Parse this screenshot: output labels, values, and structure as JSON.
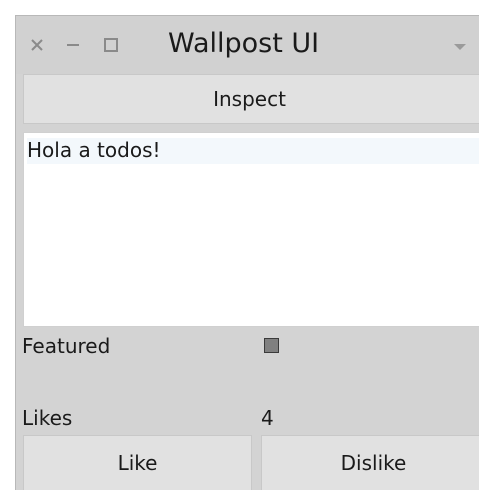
{
  "window": {
    "title": "Wallpost UI",
    "controls": {
      "close": "close-icon",
      "minimize": "minimize-icon",
      "maximize": "maximize-icon",
      "menu": "dropdown-arrow-icon"
    }
  },
  "toolbar": {
    "inspect_label": "Inspect"
  },
  "post": {
    "text": "Hola a todos!"
  },
  "fields": {
    "featured_label": "Featured",
    "featured_checked": true,
    "likes_label": "Likes",
    "likes_value": "4"
  },
  "actions": {
    "like_label": "Like",
    "dislike_label": "Dislike"
  },
  "colors": {
    "window_bg": "#d3d3d3",
    "button_bg": "#e1e1e1",
    "text": "#1a1a1a",
    "checkbox_fill": "#808080"
  }
}
